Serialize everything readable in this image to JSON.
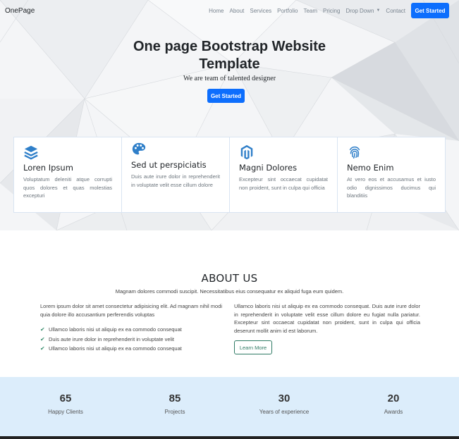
{
  "nav": {
    "brand": "OnePage",
    "items": [
      "Home",
      "About",
      "Services",
      "Portfolio",
      "Team",
      "Pricing",
      "Drop Down",
      "Contact"
    ],
    "cta": "Get Started"
  },
  "hero": {
    "title_line1": "One page Bootstrap Website",
    "title_line2": "Template",
    "subtitle": "We are team of talented designer",
    "cta": "Get Started"
  },
  "features": [
    {
      "icon": "layers-icon",
      "title": "Loren Ipsum",
      "text": "Voluptatum deleniti atque corrupti quos dolores et quas molestias excepturi"
    },
    {
      "icon": "palette-icon",
      "title": "Sed ut perspiciatis",
      "text": "Duis aute irure dolor in reprehenderit in voluptate velit esse cillum dolore"
    },
    {
      "icon": "magento-icon",
      "title": "Magni Dolores",
      "text": "Excepteur sint occaecat cupidatat non proident, sunt in culpa qui officia"
    },
    {
      "icon": "fingerprint-icon",
      "title": "Nemo Enim",
      "text": "At vero eos et accusamus et iusto odio dignissimos ducimus qui blanditiis"
    }
  ],
  "about": {
    "title": "ABOUT US",
    "description": "Magnam dolores commodi suscipit. Necessitatibus eius consequatur ex aliquid fuga eum quidem.",
    "left_text": "Lorem ipsum dolor sit amet consectetur adipisicing elit. Ad magnam nihil modi quia dolore illo accusantium perferendis voluptas",
    "list": [
      "Ullamco laboris nisi ut aliquip ex ea commodo consequat",
      "Duis aute irure dolor in reprehenderit in voluptate velit",
      "Ullamco laboris nisi ut aliquip ex ea commodo consequat"
    ],
    "right_text": "Ullamco laboris nisi ut aliquip ex ea commodo consequat. Duis aute irure dolor in reprehenderit in voluptate velit esse cillum dolore eu fugiat nulla pariatur. Excepteur sint occaecat cupidatat non proident, sunt in culpa qui officia deserunt mollit anim id est laborum.",
    "button": "Learn More"
  },
  "stats": [
    {
      "value": "65",
      "label": "Happy Clients"
    },
    {
      "value": "85",
      "label": "Projects"
    },
    {
      "value": "30",
      "label": "Years of experience"
    },
    {
      "value": "20",
      "label": "Awards"
    }
  ],
  "colors": {
    "primary": "#0d6efd",
    "icon_blue": "#2f7fc9",
    "accent_green": "#2f7a64",
    "stats_bg": "#dcedfb"
  }
}
